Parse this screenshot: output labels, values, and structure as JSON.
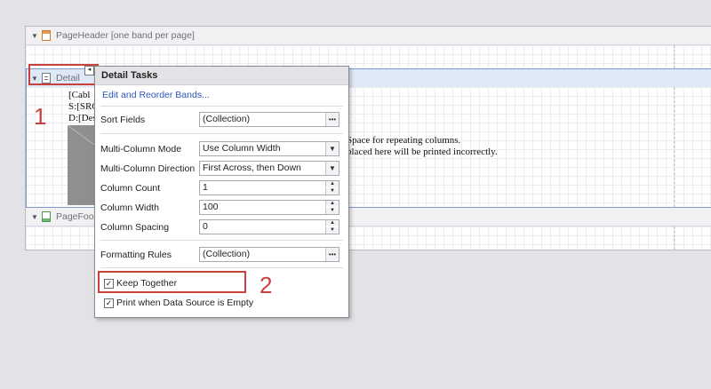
{
  "bands": {
    "page_header": "PageHeader [one band per page]",
    "detail": "Detail",
    "page_footer": "PageFoo"
  },
  "detail_content": {
    "line1": "[Cabl",
    "line2": "S:[SRC",
    "line3": "D:[Des",
    "warning_line1": "Space for repeating columns.",
    "warning_line2": "placed here will be printed incorrectly."
  },
  "callouts": {
    "one": "1",
    "two": "2"
  },
  "panel": {
    "title": "Detail Tasks",
    "edit_link": "Edit and Reorder Bands...",
    "sort_fields": {
      "label": "Sort Fields",
      "value": "(Collection)"
    },
    "multi_column_mode": {
      "label": "Multi-Column Mode",
      "value": "Use Column Width"
    },
    "multi_column_direction": {
      "label": "Multi-Column Direction",
      "value": "First Across, then Down"
    },
    "column_count": {
      "label": "Column Count",
      "value": "1"
    },
    "column_width": {
      "label": "Column Width",
      "value": "100"
    },
    "column_spacing": {
      "label": "Column Spacing",
      "value": "0"
    },
    "formatting_rules": {
      "label": "Formatting Rules",
      "value": "(Collection)"
    },
    "keep_together": {
      "label": "Keep Together",
      "checked": true
    },
    "print_when_empty": {
      "label": "Print when Data Source is Empty",
      "checked": true
    }
  },
  "colors": {
    "accent_red": "#c9413c",
    "link_blue": "#2c55b9",
    "detail_border": "#7b9bd1"
  }
}
